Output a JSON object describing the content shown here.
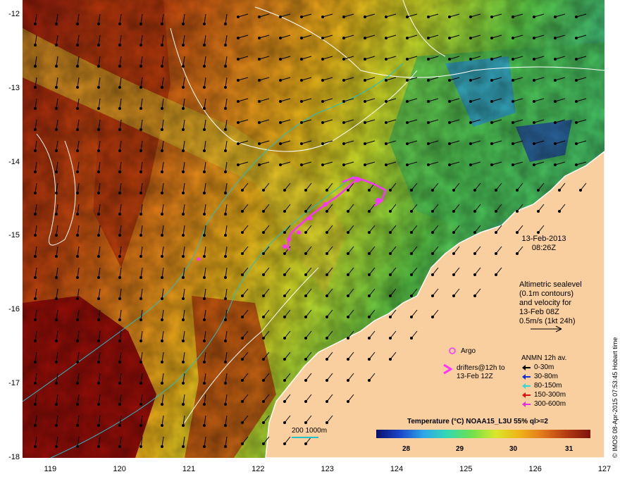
{
  "map": {
    "x_ticks": [
      "119",
      "120",
      "121",
      "122",
      "123",
      "124",
      "125",
      "126",
      "127"
    ],
    "y_ticks": [
      "-12",
      "-13",
      "-14",
      "-15",
      "-16",
      "-17",
      "-18"
    ],
    "lon_range": [
      118.6,
      127
    ],
    "lat_range": [
      -18,
      -11.8
    ],
    "land_color": "#f9cfa0",
    "current_arrow_color": "#000000",
    "drifter_color": "#ff33ff",
    "contour_color": "#ffffff",
    "isobath_color": "#22c0c8"
  },
  "annotations": {
    "date": "13-Feb-2013",
    "time": "08:26Z",
    "alt_line1": "Altimetric sealevel",
    "alt_line2": "(0.1m contours)",
    "alt_line3": "and velocity for",
    "alt_line4": "13-Feb 08Z",
    "alt_line5": "0.5m/s (1kt 24h)"
  },
  "legend": {
    "argo_label": "Argo",
    "drifter_label1": "drifters@12h to",
    "drifter_label2": "13-Feb 12Z",
    "anmn_title": "ANMN 12h av.",
    "depths": [
      {
        "label": "0-30m",
        "color": "#000000"
      },
      {
        "label": "30-80m",
        "color": "#1030d0"
      },
      {
        "label": "80-150m",
        "color": "#30d8d8"
      },
      {
        "label": "150-300m",
        "color": "#e01010"
      },
      {
        "label": "300-600m",
        "color": "#e030e0"
      }
    ]
  },
  "colorbar": {
    "title": "Temperature (°C) NOAA15_L3U 55% ql>=2",
    "ticks": [
      "28",
      "29",
      "30",
      "31"
    ]
  },
  "scale": {
    "label": "200  1000m"
  },
  "credit": "© IMOS 08-Apr-2015 07:53:45 Hobart time"
}
